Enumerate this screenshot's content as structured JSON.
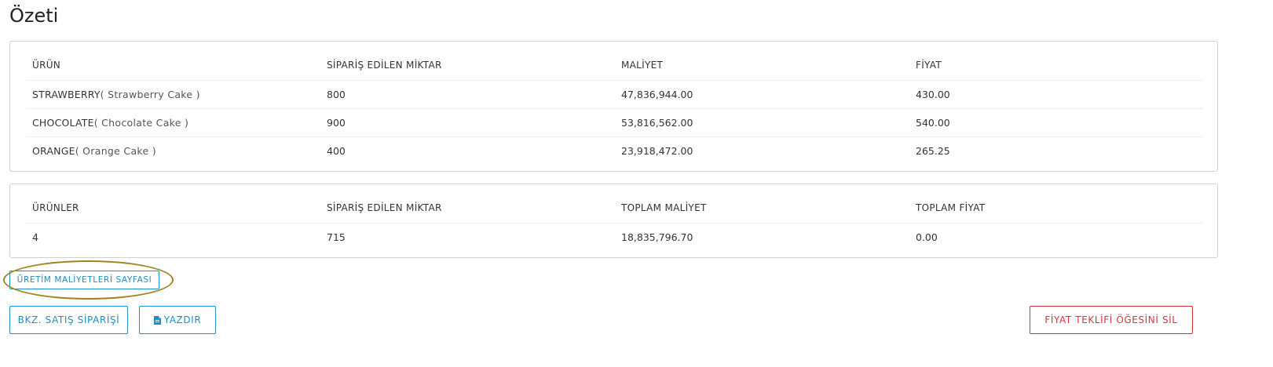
{
  "page": {
    "title": "Özeti"
  },
  "products_table": {
    "headers": [
      "ÜRÜN",
      "SİPARİŞ EDİLEN MİKTAR",
      "MALİYET",
      "FİYAT"
    ],
    "rows": [
      {
        "code": "STRAWBERRY",
        "name": "( Strawberry Cake )",
        "quantity": "800",
        "cost": "47,836,944.00",
        "price": "430.00"
      },
      {
        "code": "CHOCOLATE",
        "name": "( Chocolate Cake )",
        "quantity": "900",
        "cost": "53,816,562.00",
        "price": "540.00"
      },
      {
        "code": "ORANGE",
        "name": "( Orange Cake )",
        "quantity": "400",
        "cost": "23,918,472.00",
        "price": "265.25"
      }
    ]
  },
  "totals_table": {
    "headers": [
      "ÜRÜNLER",
      "SİPARİŞ EDİLEN MİKTAR",
      "TOPLAM MALİYET",
      "TOPLAM FİYAT"
    ],
    "row": {
      "products": "4",
      "quantity": "715",
      "total_cost": "18,835,796.70",
      "total_price": "0.00"
    }
  },
  "actions": {
    "production_costs_label": "ÜRETİM MALİYETLERİ SAYFASI",
    "sales_order_label": "BKZ. SATIŞ SİPARİŞİ",
    "print_label": "YAZDIR",
    "print_icon": "file-icon",
    "delete_label": "FİYAT TEKLİFİ ÖĞESİNİ SİL"
  },
  "colors": {
    "primary": "#1a8fc9",
    "danger": "#d9343e",
    "highlight": "#a08418"
  }
}
